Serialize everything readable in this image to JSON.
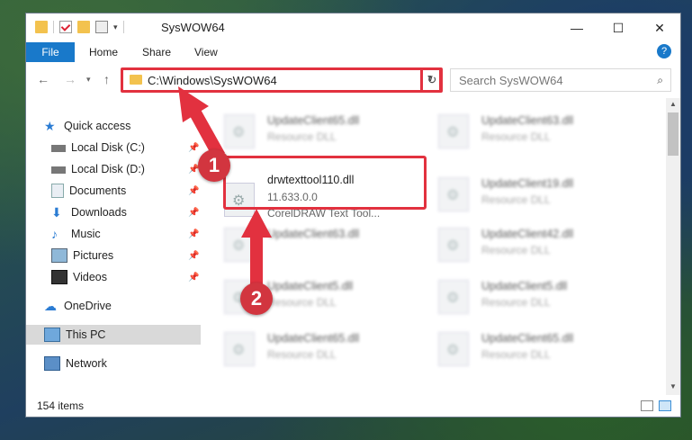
{
  "window": {
    "title": "SysWOW64",
    "minimize": "—",
    "maximize": "☐",
    "close": "✕"
  },
  "ribbon": {
    "tabs": [
      "File",
      "Home",
      "Share",
      "View"
    ],
    "help": "?"
  },
  "address": {
    "path": "C:\\Windows\\SysWOW64",
    "search_placeholder": "Search SysWOW64"
  },
  "sidebar": {
    "items": [
      {
        "label": "Quick access",
        "icon": "star-icon"
      },
      {
        "label": "Local Disk (C:)",
        "icon": "drive-icon"
      },
      {
        "label": "Local Disk (D:)",
        "icon": "drive-icon"
      },
      {
        "label": "Documents",
        "icon": "documents-icon"
      },
      {
        "label": "Downloads",
        "icon": "download-icon"
      },
      {
        "label": "Music",
        "icon": "music-icon"
      },
      {
        "label": "Pictures",
        "icon": "pictures-icon"
      },
      {
        "label": "Videos",
        "icon": "videos-icon"
      },
      {
        "label": "OneDrive",
        "icon": "cloud-icon"
      },
      {
        "label": "This PC",
        "icon": "computer-icon"
      },
      {
        "label": "Network",
        "icon": "network-icon"
      }
    ]
  },
  "files": {
    "highlighted": {
      "name": "drwtexttool110.dll",
      "version": "11.633.0.0",
      "description": "CorelDRAW Text Tool..."
    },
    "blurred": [
      {
        "name": "UpdateClient65.dll",
        "type": "Resource DLL"
      },
      {
        "name": "UpdateClient63.dll",
        "type": "Resource DLL"
      },
      {
        "name": "UpdateClient19.dll",
        "type": "Resource DLL"
      },
      {
        "name": "UpdateClient63.dll",
        "type": "Resource DLL"
      },
      {
        "name": "UpdateClient42.dll",
        "type": "Resource DLL"
      },
      {
        "name": "UpdateClient5.dll",
        "type": "Resource DLL"
      },
      {
        "name": "UpdateClient5.dll",
        "type": "Resource DLL"
      },
      {
        "name": "UpdateClient65.dll",
        "type": "Resource DLL"
      },
      {
        "name": "UpdateClient65.dll",
        "type": "Resource DLL"
      }
    ]
  },
  "status": {
    "count": "154 items"
  },
  "annotations": {
    "step1": "1",
    "step2": "2",
    "color": "#e2313f"
  }
}
